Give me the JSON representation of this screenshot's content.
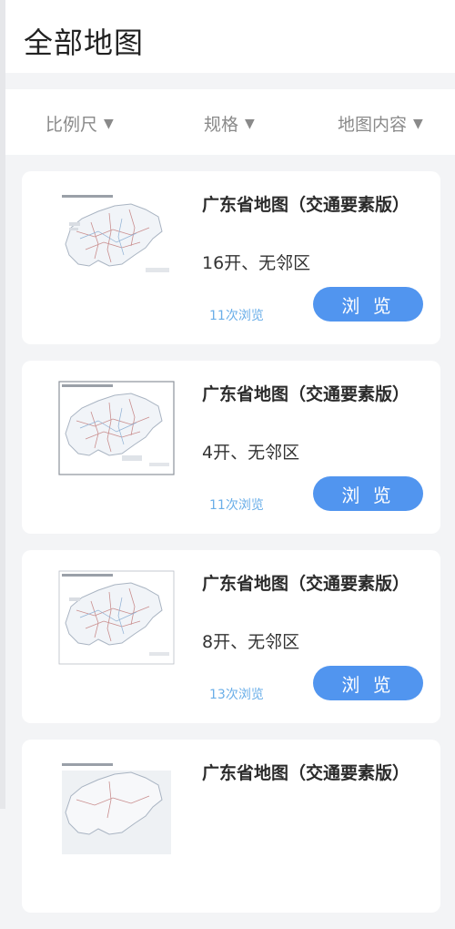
{
  "header": {
    "title": "全部地图"
  },
  "filters": [
    {
      "label": "比例尺",
      "arrow": "▼"
    },
    {
      "label": "规格",
      "arrow": "▼"
    },
    {
      "label": "地图内容",
      "arrow": "▼"
    }
  ],
  "cards": [
    {
      "title": "广东省地图（交通要素版）",
      "spec": "16开、无邻区",
      "views": "11次浏览",
      "button": "浏 览"
    },
    {
      "title": "广东省地图（交通要素版）",
      "spec": "4开、无邻区",
      "views": "11次浏览",
      "button": "浏 览"
    },
    {
      "title": "广东省地图（交通要素版）",
      "spec": "8开、无邻区",
      "views": "13次浏览",
      "button": "浏 览"
    },
    {
      "title": "广东省地图（交通要素版）",
      "spec": "",
      "views": "",
      "button": ""
    }
  ],
  "colors": {
    "accent": "#5195ef",
    "views_text": "#6aaee8"
  }
}
